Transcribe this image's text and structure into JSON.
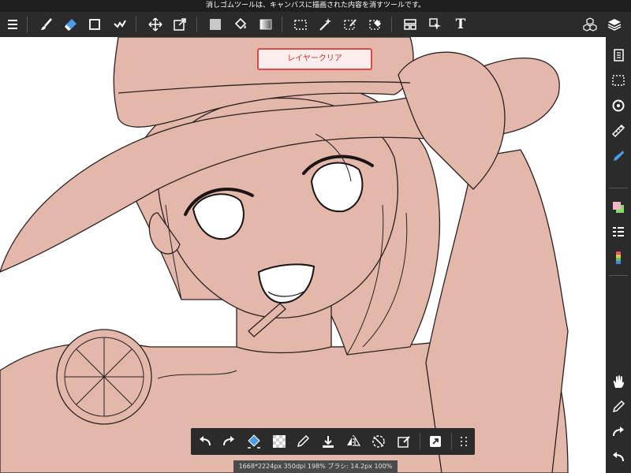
{
  "hint": "消しゴムツールは、キャンバスに描画された内容を消すツールです。",
  "toast": "レイヤークリア",
  "status": "1668*2224px 350dpi 198% ブラシ: 14.2px 100%",
  "toolbar": {
    "icons": [
      "menu-icon",
      "brush-icon",
      "eraser-icon",
      "shape-icon",
      "dot-icon",
      "move-icon",
      "transform-icon",
      "fill-color-icon",
      "bucket-icon",
      "gradient-icon",
      "select-icon",
      "magic-wand-icon",
      "select-pen-icon",
      "select-eraser-icon",
      "frame-icon",
      "pointer-icon",
      "text-icon",
      "material-icon",
      "layers-icon"
    ],
    "text_label": "T"
  },
  "sidebar": {
    "icons": [
      "pages-icon",
      "selection-icon",
      "rotate-icon",
      "ruler-icon",
      "pen-icon",
      "color-icon",
      "layer-list-icon",
      "palette-icon",
      "hand-icon",
      "eyedropper-icon",
      "redo-icon",
      "undo-icon"
    ]
  },
  "bottombar": {
    "icons": [
      "undo-icon",
      "redo-icon",
      "fill-icon",
      "transparent-icon",
      "eyedropper-icon",
      "download-icon",
      "flip-icon",
      "rotate-icon",
      "edit-icon",
      "expand-icon",
      "grid-icon"
    ]
  },
  "colors": {
    "skin": "#e3b8ab",
    "line": "#2a2020",
    "accent": "#e04848",
    "bar": "#2b2b2b"
  }
}
